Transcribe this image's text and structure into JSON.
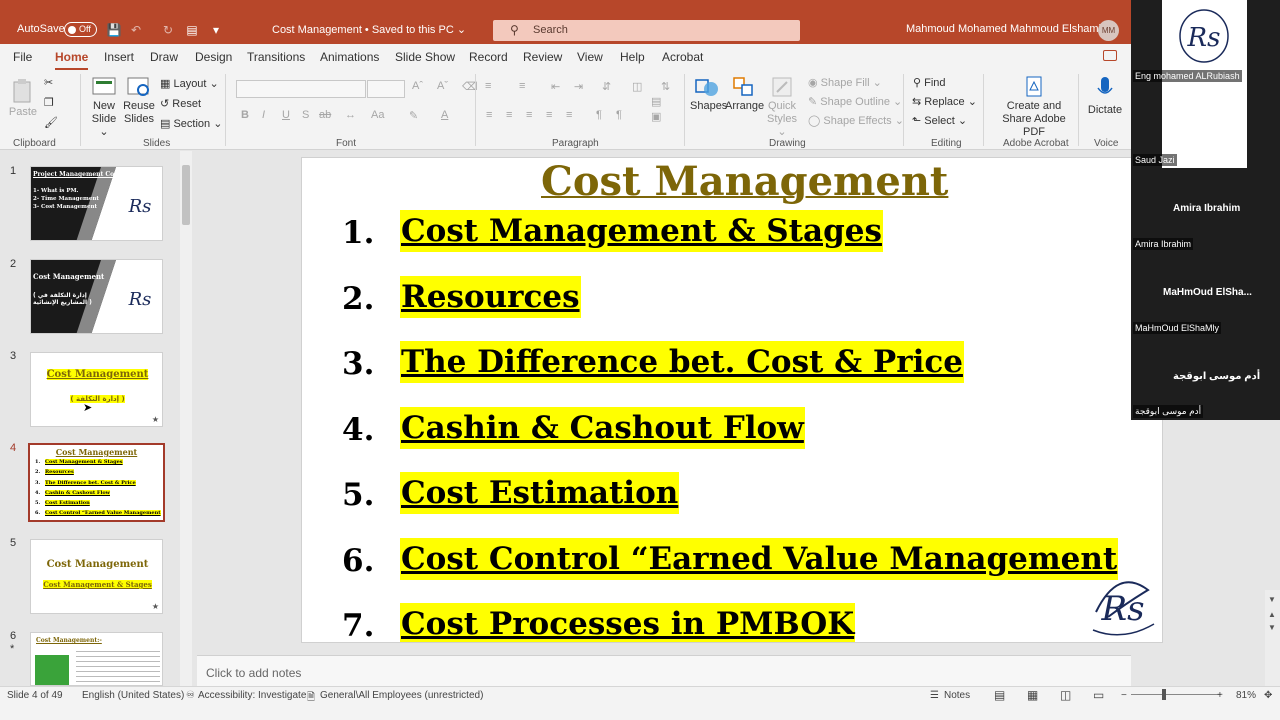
{
  "titlebar": {
    "autosave_label": "AutoSave",
    "autosave_state": "Off",
    "doc_title": "Cost Management • Saved to this PC ⌄",
    "search_placeholder": "Search",
    "username": "Mahmoud Mohamed Mahmoud Elshamly",
    "avatar_initials": "MM"
  },
  "menu": {
    "tabs": [
      "File",
      "Home",
      "Insert",
      "Draw",
      "Design",
      "Transitions",
      "Animations",
      "Slide Show",
      "Record",
      "Review",
      "View",
      "Help",
      "Acrobat"
    ],
    "active": "Home"
  },
  "ribbon": {
    "clipboard": {
      "paste": "Paste",
      "label": "Clipboard"
    },
    "slides": {
      "new_slide": "New Slide ⌄",
      "reuse_slides": "Reuse Slides",
      "layout": "Layout ⌄",
      "reset": "Reset",
      "section": "Section ⌄",
      "label": "Slides"
    },
    "font": {
      "label": "Font",
      "bold": "B",
      "italic": "I",
      "underline": "U",
      "strike": "S",
      "charspace": "ab",
      "case": "Aa",
      "color": "A"
    },
    "paragraph": {
      "label": "Paragraph"
    },
    "drawing": {
      "shapes": "Shapes",
      "arrange": "Arrange",
      "quick_styles": "Quick Styles ⌄",
      "shape_fill": "Shape Fill ⌄",
      "shape_outline": "Shape Outline ⌄",
      "shape_effects": "Shape Effects ⌄",
      "label": "Drawing"
    },
    "editing": {
      "find": "Find",
      "replace": "Replace ⌄",
      "select": "Select ⌄",
      "label": "Editing"
    },
    "adobe": {
      "create_share": "Create and Share Adobe PDF",
      "label": "Adobe Acrobat"
    },
    "voice": {
      "dictate": "Dictate",
      "label": "Voice"
    }
  },
  "thumbnails": [
    {
      "num": "1",
      "title": "Project Management Course",
      "lines": [
        "1- What is PM.",
        "2- Time Management",
        "3- Cost Management"
      ]
    },
    {
      "num": "2",
      "title": "Cost Management",
      "subtitle": "( إدارة التكلفة في المشاريع الإنشائية )"
    },
    {
      "num": "3",
      "title": "Cost Management",
      "subtitle": "( إدارة التكلفة )"
    },
    {
      "num": "4",
      "title": "Cost Management"
    },
    {
      "num": "5",
      "title": "Cost Management",
      "subtitle": "Cost Management & Stages"
    },
    {
      "num": "6",
      "title": "Cost Management:-",
      "star": "*"
    }
  ],
  "slide": {
    "title": "Cost Management",
    "items": [
      {
        "num": "1.",
        "text": "Cost Management & Stages"
      },
      {
        "num": "2.",
        "text": "Resources"
      },
      {
        "num": "3.",
        "text": "The Difference bet. Cost & Price"
      },
      {
        "num": "4.",
        "text": "Cashin & Cashout Flow"
      },
      {
        "num": "5.",
        "text": "Cost Estimation"
      },
      {
        "num": "6.",
        "text": "Cost Control “Earned Value Management"
      },
      {
        "num": "7.",
        "text": "Cost Processes in PMBOK"
      }
    ],
    "logo_text": "Rs"
  },
  "notes_placeholder": "Click to add notes",
  "participants": [
    {
      "label": "Eng mohamed ALRubiash"
    },
    {
      "label": "Saud Jazi"
    },
    {
      "center": "Amira Ibrahim",
      "label": "Amira Ibrahim"
    },
    {
      "center": "MaHmOud  ElSha...",
      "label": "MaHmOud ElShaMly"
    },
    {
      "center": "أدم موسى ابوقجة",
      "label": "أدم موسى ابوقجة"
    }
  ],
  "statusbar": {
    "slide_of": "Slide 4 of 49",
    "language": "English (United States)",
    "accessibility": "Accessibility: Investigate",
    "sensitivity": "General\\All Employees (unrestricted)",
    "notes": "Notes",
    "zoom": "81%"
  }
}
